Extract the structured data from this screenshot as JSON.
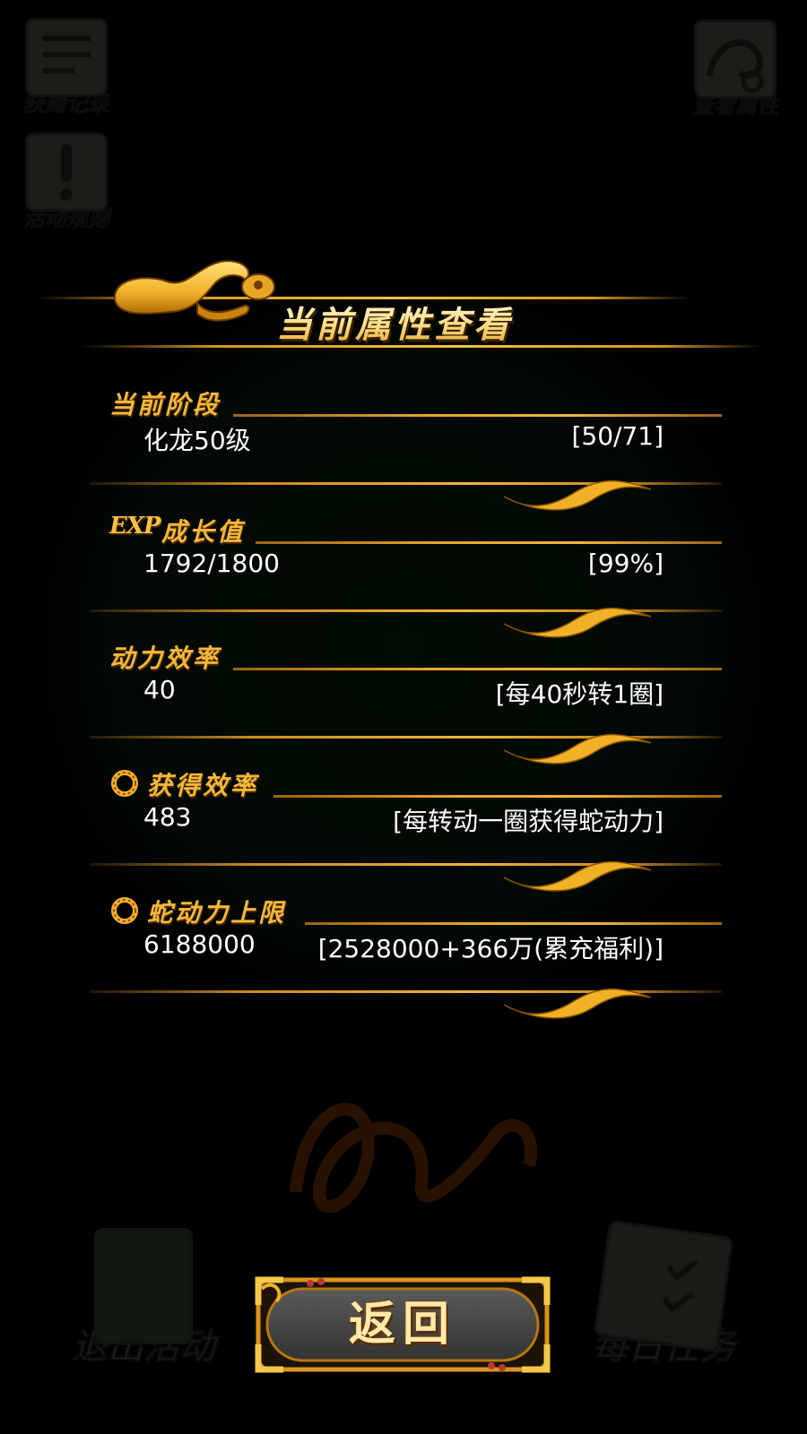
{
  "background": {
    "top_icons": [
      {
        "label": "获赠记录",
        "icon": "records-icon"
      },
      {
        "label": "活动规则",
        "icon": "rules-icon"
      },
      {
        "label": "查看属性",
        "icon": "attributes-icon"
      }
    ],
    "bottom_icons": [
      {
        "label": "退出活动",
        "icon": "exit-door-icon"
      },
      {
        "label": "每日任务",
        "icon": "daily-task-icon"
      }
    ]
  },
  "panel": {
    "title": "当前属性查看",
    "sections": [
      {
        "title": "当前阶段",
        "badge": "",
        "left": "化龙50级",
        "right": "[50/71]"
      },
      {
        "title": "成长值",
        "badge": "EXP",
        "left": "1792/1800",
        "right": "[99%]"
      },
      {
        "title": "动力效率",
        "badge": "",
        "left": "40",
        "right": "[每40秒转1圈]"
      },
      {
        "title": "获得效率",
        "badge": "ring-icon",
        "left": "483",
        "right": "[每转动一圈获得蛇动力]"
      },
      {
        "title": "蛇动力上限",
        "badge": "ring-icon",
        "left": "6188000",
        "right": "[2528000+366万(累充福利)]"
      }
    ]
  },
  "back_button": {
    "label": "返回"
  },
  "colors": {
    "gold": "#f4b83a",
    "gold_light": "#ffe08a",
    "button_face": "#4a4a4a",
    "background": "#000000"
  }
}
